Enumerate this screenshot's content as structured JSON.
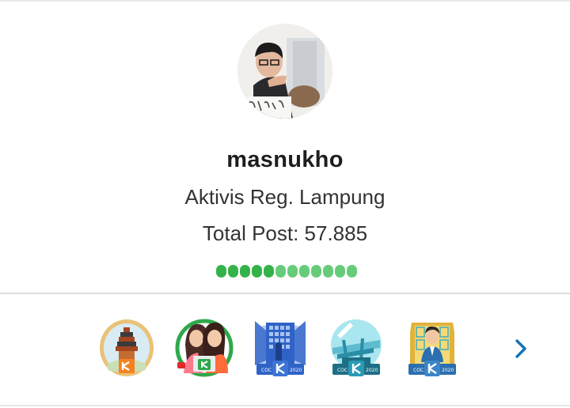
{
  "profile": {
    "username": "masnukho",
    "rank": "Aktivis Reg. Lampung",
    "total_post": "Total Post: 57.885"
  },
  "progress": {
    "dot_colors": [
      "#34b24a",
      "#34b24a",
      "#34b24a",
      "#34b24a",
      "#34b24a",
      "#66cc7a",
      "#66cc7a",
      "#66cc7a",
      "#66cc7a",
      "#66cc7a",
      "#66cc7a",
      "#66cc7a"
    ]
  },
  "badges": [
    {
      "name": "badge-temple"
    },
    {
      "name": "badge-women-laptop"
    },
    {
      "name": "badge-coc-2020-building"
    },
    {
      "name": "badge-coc-2020-bridge"
    },
    {
      "name": "badge-coc-2020-person"
    }
  ],
  "icons": {
    "next": "chevron-right-icon"
  },
  "colors": {
    "accent_green": "#34b24a",
    "chevron_blue": "#1473b8"
  }
}
